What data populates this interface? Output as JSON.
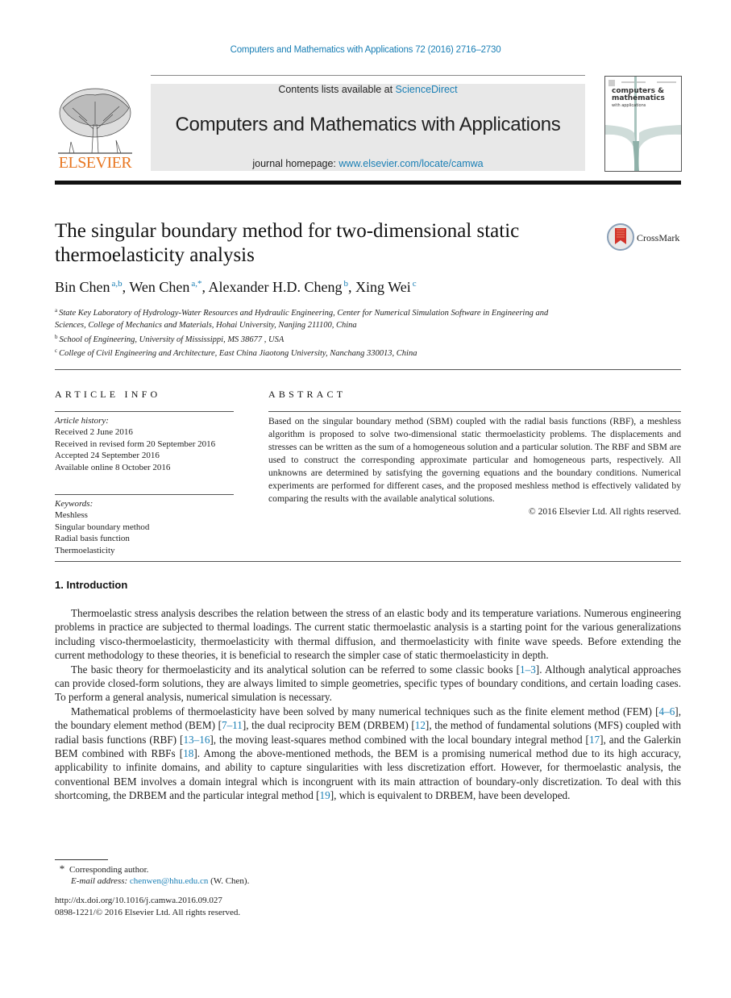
{
  "header": {
    "journal_reference": "Computers and Mathematics with Applications 72 (2016) 2716–2730",
    "contents_prefix": "Contents lists available at ",
    "contents_link": "ScienceDirect",
    "journal_title": "Computers and Mathematics with Applications",
    "homepage_prefix": "journal homepage: ",
    "homepage_link": "www.elsevier.com/locate/camwa",
    "publisher_logo_text": "ELSEVIER",
    "cover": {
      "line1": "computers &",
      "line2": "mathematics",
      "line3": "with applications"
    },
    "crossmark_label": "CrossMark",
    "accent_color": "#1a7fb5",
    "elsevier_color": "#e87722"
  },
  "article": {
    "title": "The singular boundary method for two-dimensional static thermoelasticity analysis",
    "authors": [
      {
        "name": "Bin Chen",
        "affil": "a,b"
      },
      {
        "name": "Wen Chen",
        "affil": "a,*"
      },
      {
        "name": "Alexander H.D. Cheng",
        "affil": "b"
      },
      {
        "name": "Xing Wei",
        "affil": "c"
      }
    ],
    "affiliations": [
      {
        "mark": "a",
        "text": "State Key Laboratory of Hydrology-Water Resources and Hydraulic Engineering, Center for Numerical Simulation Software in Engineering and Sciences, College of Mechanics and Materials, Hohai University, Nanjing 211100, China"
      },
      {
        "mark": "b",
        "text": "School of Engineering, University of Mississippi, MS 38677 , USA"
      },
      {
        "mark": "c",
        "text": "College of Civil Engineering and Architecture, East China Jiaotong University, Nanchang 330013, China"
      }
    ]
  },
  "article_info": {
    "heading": "ARTICLE INFO",
    "history_label": "Article history:",
    "history": [
      "Received 2 June 2016",
      "Received in revised form 20 September 2016",
      "Accepted 24 September 2016",
      "Available online 8 October 2016"
    ],
    "keywords_label": "Keywords:",
    "keywords": [
      "Meshless",
      "Singular boundary method",
      "Radial basis function",
      "Thermoelasticity"
    ]
  },
  "abstract": {
    "heading": "ABSTRACT",
    "text": "Based on the singular boundary method (SBM) coupled with the radial basis functions (RBF), a meshless algorithm is proposed to solve two-dimensional static thermoelasticity problems. The displacements and stresses can be written as the sum of a homogeneous solution and a particular solution. The RBF and SBM are used to construct the corresponding approximate particular and homogeneous parts, respectively. All unknowns are determined by satisfying the governing equations and the boundary conditions. Numerical experiments are performed for different cases, and the proposed meshless method is effectively validated by comparing the results with the available analytical solutions.",
    "copyright": "© 2016 Elsevier Ltd. All rights reserved."
  },
  "introduction": {
    "heading": "1.  Introduction",
    "p1": "Thermoelastic stress analysis describes the relation between the stress of an elastic body and its temperature variations. Numerous engineering problems in practice are subjected to thermal loadings. The current static thermoelastic analysis is a starting point for the various generalizations including visco-thermoelasticity, thermoelasticity with thermal diffusion, and thermoelasticity with finite wave speeds. Before extending the current methodology to these theories, it is beneficial to research the simpler case of static thermoelasticity in depth.",
    "p2_a": "The basic theory for thermoelasticity and its analytical solution can be referred to some classic books [",
    "p2_ref1": "1–3",
    "p2_b": "]. Although analytical approaches can provide closed-form solutions, they are always limited to simple geometries, specific types of boundary conditions, and certain loading cases. To perform a general analysis, numerical simulation is necessary.",
    "p3_a": "Mathematical problems of thermoelasticity have been solved by many numerical techniques such as the finite element method (FEM) [",
    "p3_ref1": "4–6",
    "p3_b": "], the boundary element method (BEM) [",
    "p3_ref2": "7–11",
    "p3_c": "], the dual reciprocity BEM (DRBEM) [",
    "p3_ref3": "12",
    "p3_d": "], the method of fundamental solutions (MFS) coupled with radial basis functions (RBF) [",
    "p3_ref4": "13–16",
    "p3_e": "], the moving least-squares method combined with the local boundary integral method [",
    "p3_ref5": "17",
    "p3_f": "], and the Galerkin BEM combined with RBFs [",
    "p3_ref6": "18",
    "p3_g": "]. Among the above-mentioned methods, the BEM is a promising numerical method due to its high accuracy, applicability to infinite domains, and ability to capture singularities with less discretization effort. However, for thermoelastic analysis, the conventional BEM involves a domain integral which is incongruent with its main attraction of boundary-only discretization. To deal with this shortcoming, the DRBEM and the particular integral method [",
    "p3_ref7": "19",
    "p3_h": "], which is equivalent to DRBEM, have been developed."
  },
  "footnotes": {
    "star": "*",
    "corresponding": "Corresponding author.",
    "email_label": "E-mail address: ",
    "email": "chenwen@hhu.edu.cn",
    "email_suffix": " (W. Chen).",
    "doi": "http://dx.doi.org/10.1016/j.camwa.2016.09.027",
    "issn": "0898-1221/© 2016 Elsevier Ltd. All rights reserved."
  }
}
